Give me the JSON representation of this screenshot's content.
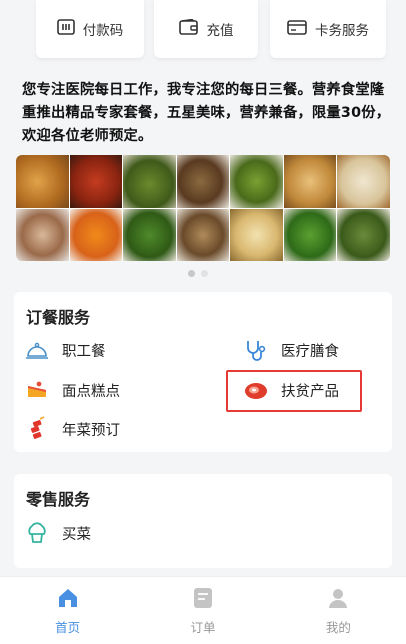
{
  "pay_buttons": [
    {
      "label": "付款码",
      "icon": "qr-code-icon"
    },
    {
      "label": "充值",
      "icon": "wallet-icon"
    },
    {
      "label": "卡务服务",
      "icon": "card-icon"
    }
  ],
  "notice": "您专注医院每日工作，我专注您的每日三餐。营养食堂隆重推出精品专家套餐，五星美味，营养兼备，限量30份，欢迎各位老师预定。",
  "banner": {
    "page_count": 2,
    "current_page": 1
  },
  "ordering": {
    "title": "订餐服务",
    "items": [
      {
        "label": "职工餐",
        "icon": "dish-cover-icon"
      },
      {
        "label": "医疗膳食",
        "icon": "stethoscope-icon"
      },
      {
        "label": "面点糕点",
        "icon": "cake-icon"
      },
      {
        "label": "扶贫产品",
        "icon": "meat-icon"
      },
      {
        "label": "年菜预订",
        "icon": "firecracker-icon"
      }
    ]
  },
  "retail": {
    "title": "零售服务",
    "items": [
      {
        "label": "买菜",
        "icon": "vegetable-icon"
      }
    ]
  },
  "tabbar": [
    {
      "label": "首页",
      "icon": "home-icon",
      "active": true
    },
    {
      "label": "订单",
      "icon": "order-icon",
      "active": false
    },
    {
      "label": "我的",
      "icon": "user-icon",
      "active": false
    }
  ],
  "colors": {
    "accent": "#4a90e2",
    "highlight": "#e53935"
  }
}
